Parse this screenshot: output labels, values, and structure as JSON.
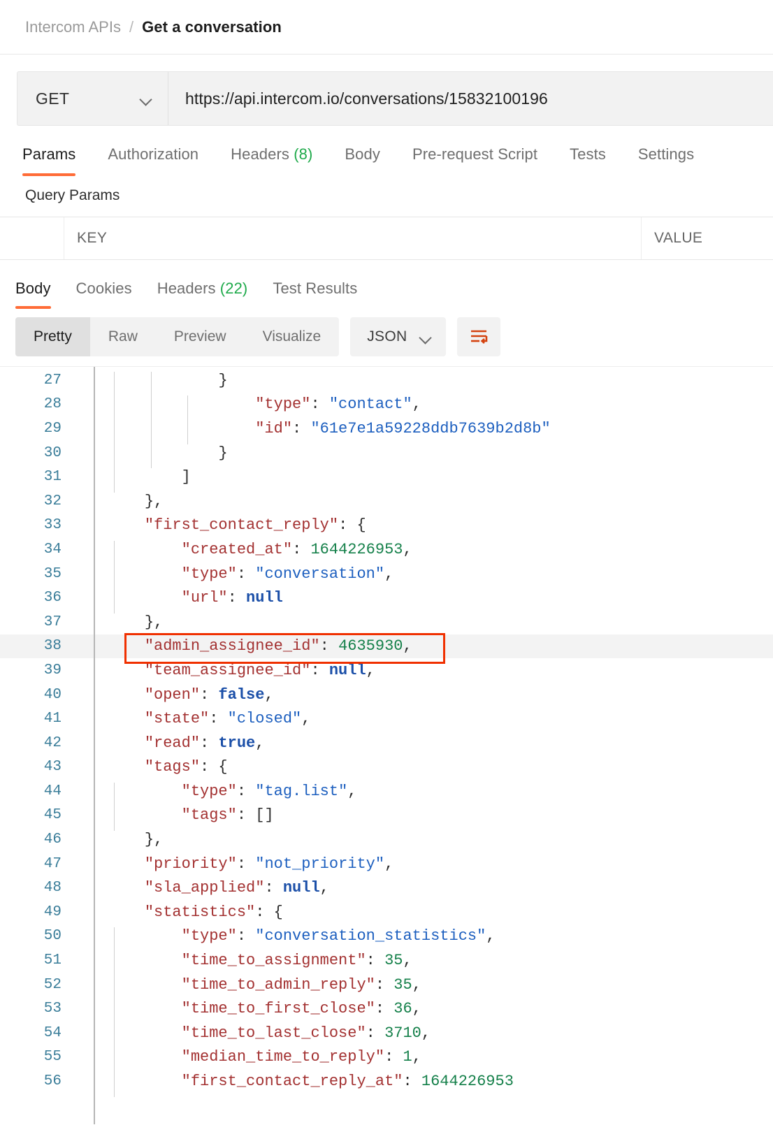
{
  "breadcrumb": {
    "collection": "Intercom APIs",
    "separator": "/",
    "current": "Get a conversation"
  },
  "request": {
    "method": "GET",
    "url": "https://api.intercom.io/conversations/15832100196",
    "method_chevron_icon": "chevron-down-icon",
    "tabs": [
      {
        "label": "Params",
        "count": "",
        "active": true
      },
      {
        "label": "Authorization",
        "count": "",
        "active": false
      },
      {
        "label": "Headers",
        "count": "(8)",
        "active": false
      },
      {
        "label": "Body",
        "count": "",
        "active": false
      },
      {
        "label": "Pre-request Script",
        "count": "",
        "active": false
      },
      {
        "label": "Tests",
        "count": "",
        "active": false
      },
      {
        "label": "Settings",
        "count": "",
        "active": false
      }
    ],
    "query_params_label": "Query Params",
    "params_table": {
      "headers": {
        "key": "KEY",
        "value": "VALUE"
      },
      "rows": []
    }
  },
  "response": {
    "tabs": [
      {
        "label": "Body",
        "count": "",
        "active": true
      },
      {
        "label": "Cookies",
        "count": "",
        "active": false
      },
      {
        "label": "Headers",
        "count": "(22)",
        "active": false
      },
      {
        "label": "Test Results",
        "count": "",
        "active": false
      }
    ],
    "format_segments": [
      {
        "label": "Pretty",
        "active": true
      },
      {
        "label": "Raw",
        "active": false
      },
      {
        "label": "Preview",
        "active": false
      },
      {
        "label": "Visualize",
        "active": false
      }
    ],
    "language_select": {
      "label": "JSON",
      "icon": "chevron-down-icon"
    },
    "wrap_button_icon": "wrap-lines-icon"
  },
  "colors": {
    "accent": "#ff6c37",
    "highlight_box": "#f03000",
    "json_key": "#a33131",
    "json_string": "#1d5fbf",
    "json_number": "#15804a",
    "json_literal": "#1b4fa8",
    "line_number": "#3a7d99",
    "count_badge": "#1faa4b"
  },
  "code": {
    "highlighted_line": 38,
    "lines": [
      {
        "n": 27,
        "indent": 3,
        "tokens": [
          {
            "t": "}",
            "c": "p"
          }
        ]
      },
      {
        "n": 28,
        "indent": 4,
        "tokens": [
          {
            "t": "\"type\"",
            "c": "k"
          },
          {
            "t": ": ",
            "c": "p"
          },
          {
            "t": "\"contact\"",
            "c": "s"
          },
          {
            "t": ",",
            "c": "p"
          }
        ]
      },
      {
        "n": 29,
        "indent": 4,
        "tokens": [
          {
            "t": "\"id\"",
            "c": "k"
          },
          {
            "t": ": ",
            "c": "p"
          },
          {
            "t": "\"61e7e1a59228ddb7639b2d8b\"",
            "c": "s"
          }
        ]
      },
      {
        "n": 30,
        "indent": 3,
        "tokens": [
          {
            "t": "}",
            "c": "p"
          }
        ]
      },
      {
        "n": 31,
        "indent": 2,
        "tokens": [
          {
            "t": "]",
            "c": "p"
          }
        ]
      },
      {
        "n": 32,
        "indent": 1,
        "tokens": [
          {
            "t": "},",
            "c": "p"
          }
        ]
      },
      {
        "n": 33,
        "indent": 1,
        "tokens": [
          {
            "t": "\"first_contact_reply\"",
            "c": "k"
          },
          {
            "t": ": {",
            "c": "p"
          }
        ]
      },
      {
        "n": 34,
        "indent": 2,
        "tokens": [
          {
            "t": "\"created_at\"",
            "c": "k"
          },
          {
            "t": ": ",
            "c": "p"
          },
          {
            "t": "1644226953",
            "c": "n"
          },
          {
            "t": ",",
            "c": "p"
          }
        ]
      },
      {
        "n": 35,
        "indent": 2,
        "tokens": [
          {
            "t": "\"type\"",
            "c": "k"
          },
          {
            "t": ": ",
            "c": "p"
          },
          {
            "t": "\"conversation\"",
            "c": "s"
          },
          {
            "t": ",",
            "c": "p"
          }
        ]
      },
      {
        "n": 36,
        "indent": 2,
        "tokens": [
          {
            "t": "\"url\"",
            "c": "k"
          },
          {
            "t": ": ",
            "c": "p"
          },
          {
            "t": "null",
            "c": "b"
          }
        ]
      },
      {
        "n": 37,
        "indent": 1,
        "tokens": [
          {
            "t": "},",
            "c": "p"
          }
        ]
      },
      {
        "n": 38,
        "indent": 1,
        "tokens": [
          {
            "t": "\"admin_assignee_id\"",
            "c": "k"
          },
          {
            "t": ": ",
            "c": "p"
          },
          {
            "t": "4635930",
            "c": "n"
          },
          {
            "t": ",",
            "c": "p"
          }
        ]
      },
      {
        "n": 39,
        "indent": 1,
        "tokens": [
          {
            "t": "\"team_assignee_id\"",
            "c": "k"
          },
          {
            "t": ": ",
            "c": "p"
          },
          {
            "t": "null",
            "c": "b"
          },
          {
            "t": ",",
            "c": "p"
          }
        ]
      },
      {
        "n": 40,
        "indent": 1,
        "tokens": [
          {
            "t": "\"open\"",
            "c": "k"
          },
          {
            "t": ": ",
            "c": "p"
          },
          {
            "t": "false",
            "c": "b"
          },
          {
            "t": ",",
            "c": "p"
          }
        ]
      },
      {
        "n": 41,
        "indent": 1,
        "tokens": [
          {
            "t": "\"state\"",
            "c": "k"
          },
          {
            "t": ": ",
            "c": "p"
          },
          {
            "t": "\"closed\"",
            "c": "s"
          },
          {
            "t": ",",
            "c": "p"
          }
        ]
      },
      {
        "n": 42,
        "indent": 1,
        "tokens": [
          {
            "t": "\"read\"",
            "c": "k"
          },
          {
            "t": ": ",
            "c": "p"
          },
          {
            "t": "true",
            "c": "b"
          },
          {
            "t": ",",
            "c": "p"
          }
        ]
      },
      {
        "n": 43,
        "indent": 1,
        "tokens": [
          {
            "t": "\"tags\"",
            "c": "k"
          },
          {
            "t": ": {",
            "c": "p"
          }
        ]
      },
      {
        "n": 44,
        "indent": 2,
        "tokens": [
          {
            "t": "\"type\"",
            "c": "k"
          },
          {
            "t": ": ",
            "c": "p"
          },
          {
            "t": "\"tag.list\"",
            "c": "s"
          },
          {
            "t": ",",
            "c": "p"
          }
        ]
      },
      {
        "n": 45,
        "indent": 2,
        "tokens": [
          {
            "t": "\"tags\"",
            "c": "k"
          },
          {
            "t": ": []",
            "c": "p"
          }
        ]
      },
      {
        "n": 46,
        "indent": 1,
        "tokens": [
          {
            "t": "},",
            "c": "p"
          }
        ]
      },
      {
        "n": 47,
        "indent": 1,
        "tokens": [
          {
            "t": "\"priority\"",
            "c": "k"
          },
          {
            "t": ": ",
            "c": "p"
          },
          {
            "t": "\"not_priority\"",
            "c": "s"
          },
          {
            "t": ",",
            "c": "p"
          }
        ]
      },
      {
        "n": 48,
        "indent": 1,
        "tokens": [
          {
            "t": "\"sla_applied\"",
            "c": "k"
          },
          {
            "t": ": ",
            "c": "p"
          },
          {
            "t": "null",
            "c": "b"
          },
          {
            "t": ",",
            "c": "p"
          }
        ]
      },
      {
        "n": 49,
        "indent": 1,
        "tokens": [
          {
            "t": "\"statistics\"",
            "c": "k"
          },
          {
            "t": ": {",
            "c": "p"
          }
        ]
      },
      {
        "n": 50,
        "indent": 2,
        "tokens": [
          {
            "t": "\"type\"",
            "c": "k"
          },
          {
            "t": ": ",
            "c": "p"
          },
          {
            "t": "\"conversation_statistics\"",
            "c": "s"
          },
          {
            "t": ",",
            "c": "p"
          }
        ]
      },
      {
        "n": 51,
        "indent": 2,
        "tokens": [
          {
            "t": "\"time_to_assignment\"",
            "c": "k"
          },
          {
            "t": ": ",
            "c": "p"
          },
          {
            "t": "35",
            "c": "n"
          },
          {
            "t": ",",
            "c": "p"
          }
        ]
      },
      {
        "n": 52,
        "indent": 2,
        "tokens": [
          {
            "t": "\"time_to_admin_reply\"",
            "c": "k"
          },
          {
            "t": ": ",
            "c": "p"
          },
          {
            "t": "35",
            "c": "n"
          },
          {
            "t": ",",
            "c": "p"
          }
        ]
      },
      {
        "n": 53,
        "indent": 2,
        "tokens": [
          {
            "t": "\"time_to_first_close\"",
            "c": "k"
          },
          {
            "t": ": ",
            "c": "p"
          },
          {
            "t": "36",
            "c": "n"
          },
          {
            "t": ",",
            "c": "p"
          }
        ]
      },
      {
        "n": 54,
        "indent": 2,
        "tokens": [
          {
            "t": "\"time_to_last_close\"",
            "c": "k"
          },
          {
            "t": ": ",
            "c": "p"
          },
          {
            "t": "3710",
            "c": "n"
          },
          {
            "t": ",",
            "c": "p"
          }
        ]
      },
      {
        "n": 55,
        "indent": 2,
        "tokens": [
          {
            "t": "\"median_time_to_reply\"",
            "c": "k"
          },
          {
            "t": ": ",
            "c": "p"
          },
          {
            "t": "1",
            "c": "n"
          },
          {
            "t": ",",
            "c": "p"
          }
        ]
      },
      {
        "n": 56,
        "indent": 2,
        "tokens": [
          {
            "t": "\"first_contact_reply_at\"",
            "c": "k"
          },
          {
            "t": ": ",
            "c": "p"
          },
          {
            "t": "1644226953",
            "c": "n"
          }
        ]
      }
    ]
  }
}
